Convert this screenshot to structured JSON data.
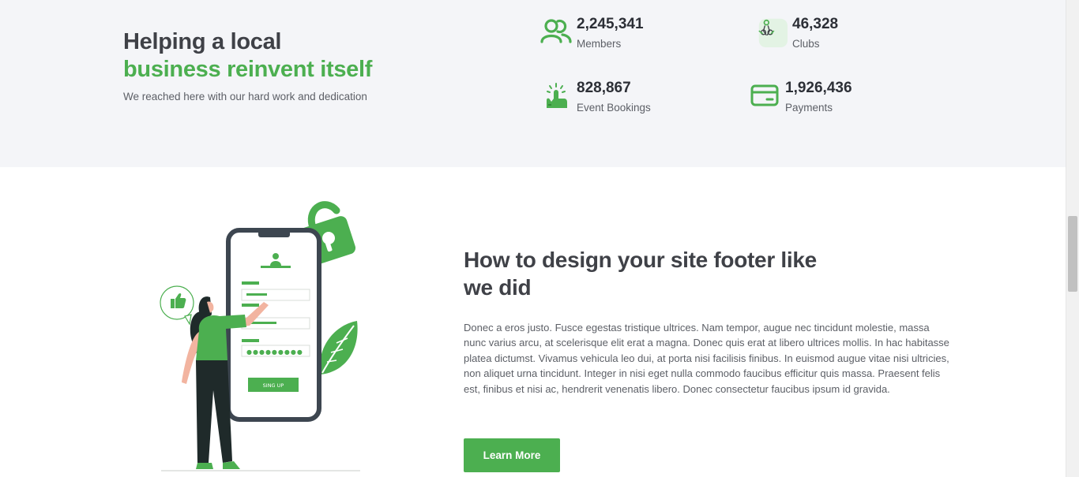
{
  "stats_section": {
    "heading_line1": "Helping a local",
    "heading_line2": "business reinvent itself",
    "subtitle": "We reached here with our hard work and dedication",
    "stats": [
      {
        "value": "2,245,341",
        "label": "Members",
        "icon": "members-icon"
      },
      {
        "value": "46,328",
        "label": "Clubs",
        "icon": "clubs-icon"
      },
      {
        "value": "828,867",
        "label": "Event Bookings",
        "icon": "event-bookings-icon"
      },
      {
        "value": "1,926,436",
        "label": "Payments",
        "icon": "payments-icon"
      }
    ]
  },
  "feature_section": {
    "title": "How to design your site footer like we did",
    "body": "Donec a eros justo. Fusce egestas tristique ultrices. Nam tempor, augue nec tincidunt molestie, massa nunc varius arcu, at scelerisque elit erat a magna. Donec quis erat at libero ultrices mollis. In hac habitasse platea dictumst. Vivamus vehicula leo dui, at porta nisi facilisis finibus. In euismod augue vitae nisi ultricies, non aliquet urna tincidunt. Integer in nisi eget nulla commodo faucibus efficitur quis massa. Praesent felis est, finibus et nisi ac, hendrerit venenatis libero. Donec consectetur faucibus ipsum id gravida.",
    "button_label": "Learn More",
    "illustration_button_text": "SING UP"
  },
  "colors": {
    "accent": "#4caf50",
    "heading": "#3f4147",
    "band_background": "#f4f5f8"
  }
}
